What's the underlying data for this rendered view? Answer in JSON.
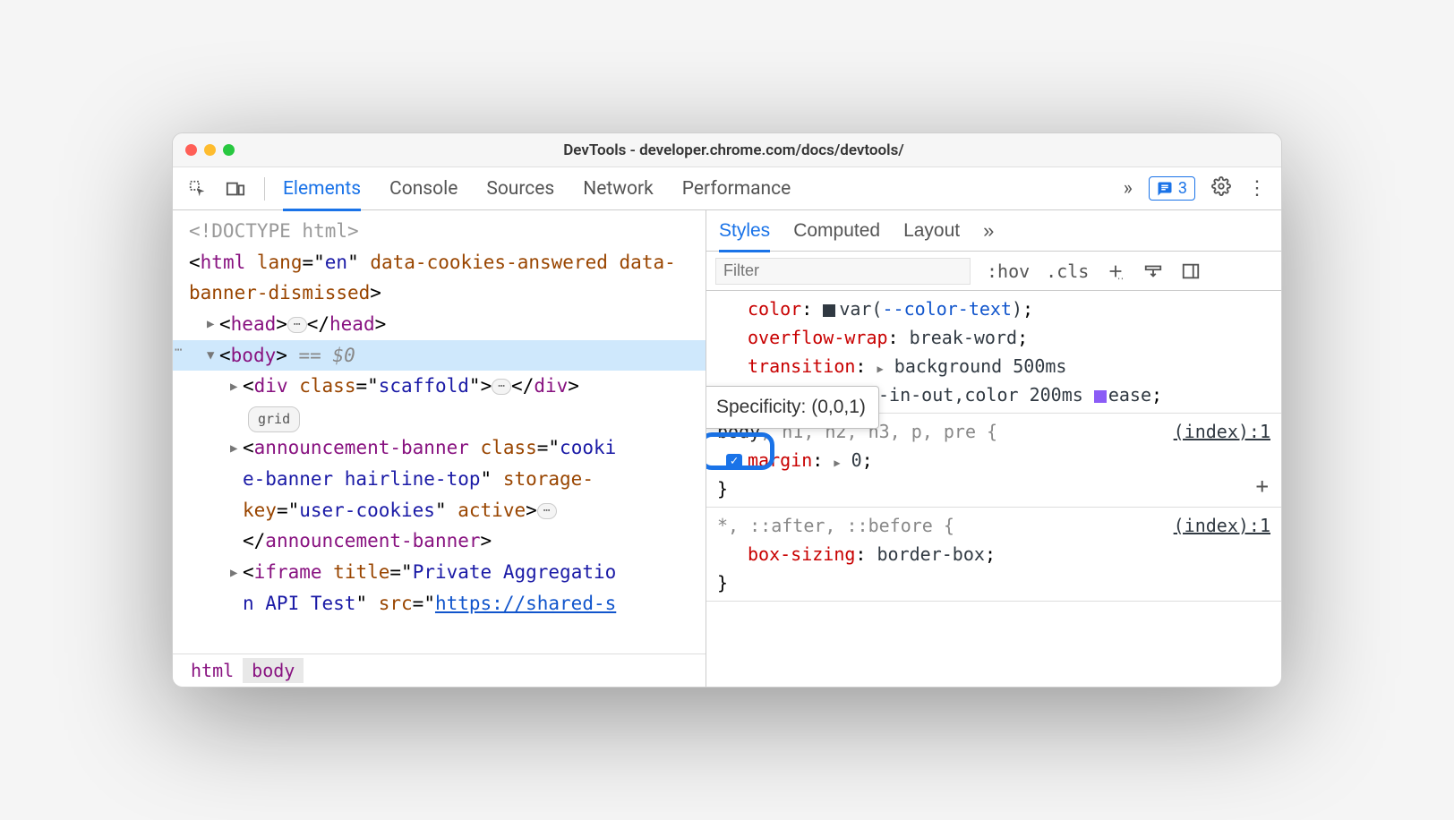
{
  "window": {
    "title": "DevTools - developer.chrome.com/docs/devtools/"
  },
  "toolbar": {
    "tabs": [
      "Elements",
      "Console",
      "Sources",
      "Network",
      "Performance"
    ],
    "active_tab": 0,
    "issues_count": "3"
  },
  "dom": {
    "doctype": "<!DOCTYPE html>",
    "html_open": "<html lang=\"en\" data-cookies-answered data-banner-dismissed>",
    "head_open": "<head>",
    "head_close": "</head>",
    "body_open": "<body>",
    "body_eq": " == $0",
    "div_open": "<div class=\"scaffold\">",
    "div_close": "</div>",
    "grid_badge": "grid",
    "banner_open_a": "<announcement-banner class=\"cooki",
    "banner_open_b": "e-banner hairline-top\" storage-",
    "banner_open_c": "key=\"user-cookies\" active>",
    "banner_close": "</announcement-banner>",
    "iframe_a": "<iframe title=\"Private Aggregatio",
    "iframe_b": "n API Test\" src=\"",
    "iframe_url": "https://shared-s"
  },
  "breadcrumbs": [
    "html",
    "body"
  ],
  "right_tabs": [
    "Styles",
    "Computed",
    "Layout"
  ],
  "right_active": 0,
  "filter": {
    "placeholder": "Filter",
    "hov": ":hov",
    "cls": ".cls"
  },
  "styles": {
    "rule0": {
      "p0_name": "color",
      "p0_val_var": "var",
      "p0_var_name": "--color-text",
      "p1_name": "overflow-wrap",
      "p1_val": "break-word",
      "p2_name": "transition",
      "p2_val_a": "background 500ms",
      "p2_val_b": "-in-out,color 200ms ",
      "p2_val_c": "ease"
    },
    "tooltip": "Specificity: (0,0,1)",
    "rule1": {
      "selector_match": "body",
      "selector_rest": ", h1, h2, h3, p, pre {",
      "source": "(index):1",
      "p0_name": "margin",
      "p0_val": "0"
    },
    "rule2": {
      "selector": "*, ::after, ::before {",
      "source": "(index):1",
      "p0_name": "box-sizing",
      "p0_val": "border-box"
    },
    "brace_close": "}"
  }
}
